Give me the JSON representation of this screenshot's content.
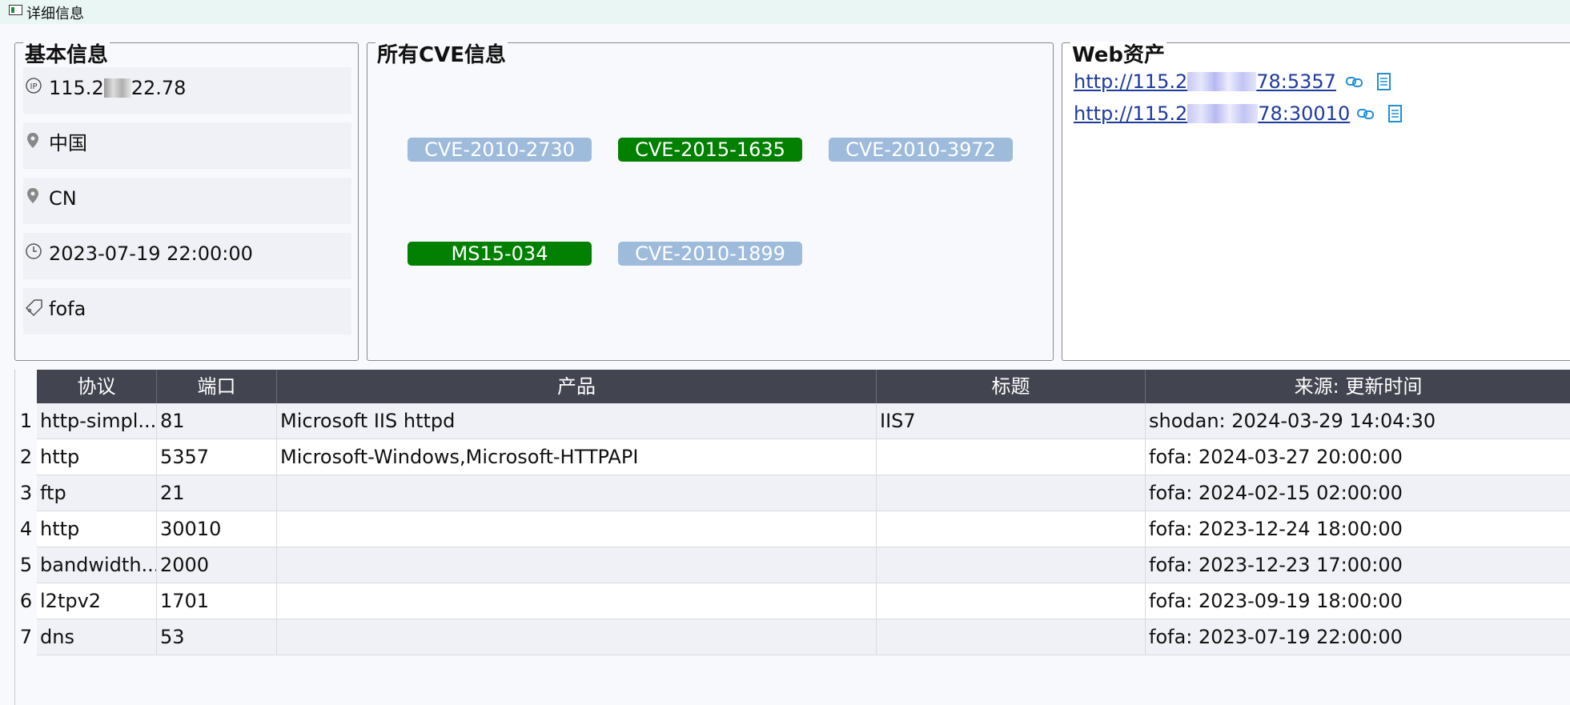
{
  "window": {
    "title": "详细信息"
  },
  "basic": {
    "title": "基本信息",
    "ip_prefix": "115.2",
    "ip_suffix": "22.78",
    "country": "中国",
    "country_code": "CN",
    "time": "2023-07-19 22:00:00",
    "source": "fofa"
  },
  "cve": {
    "title": "所有CVE信息",
    "tags": [
      {
        "label": "CVE-2010-2730",
        "color": "#9ebbdc"
      },
      {
        "label": "CVE-2015-1635",
        "color": "#028002"
      },
      {
        "label": "CVE-2010-3972",
        "color": "#9ebbdc"
      },
      {
        "label": "MS15-034",
        "color": "#028002"
      },
      {
        "label": "CVE-2010-1899",
        "color": "#9ebbdc"
      }
    ]
  },
  "web": {
    "title": "Web资产",
    "links": [
      {
        "prefix": "http://115.2",
        "suffix": "78:5357"
      },
      {
        "prefix": "http://115.2",
        "suffix": "78:30010"
      }
    ]
  },
  "table": {
    "headers": [
      "协议",
      "端口",
      "产品",
      "标题",
      "来源: 更新时间"
    ],
    "rows": [
      {
        "num": "1",
        "protocol": "http-simpl...",
        "port": "81",
        "product": "Microsoft IIS httpd",
        "title": "IIS7",
        "source_time": "shodan: 2024-03-29 14:04:30"
      },
      {
        "num": "2",
        "protocol": "http",
        "port": "5357",
        "product": "Microsoft-Windows,Microsoft-HTTPAPI",
        "title": "",
        "source_time": "fofa: 2024-03-27 20:00:00"
      },
      {
        "num": "3",
        "protocol": "ftp",
        "port": "21",
        "product": "",
        "title": "",
        "source_time": "fofa: 2024-02-15 02:00:00"
      },
      {
        "num": "4",
        "protocol": "http",
        "port": "30010",
        "product": "",
        "title": "",
        "source_time": "fofa: 2023-12-24 18:00:00"
      },
      {
        "num": "5",
        "protocol": "bandwidth...",
        "port": "2000",
        "product": "",
        "title": "",
        "source_time": "fofa: 2023-12-23 17:00:00"
      },
      {
        "num": "6",
        "protocol": "l2tpv2",
        "port": "1701",
        "product": "",
        "title": "",
        "source_time": "fofa: 2023-09-19 18:00:00"
      },
      {
        "num": "7",
        "protocol": "dns",
        "port": "53",
        "product": "",
        "title": "",
        "source_time": "fofa: 2023-07-19 22:00:00"
      }
    ]
  }
}
